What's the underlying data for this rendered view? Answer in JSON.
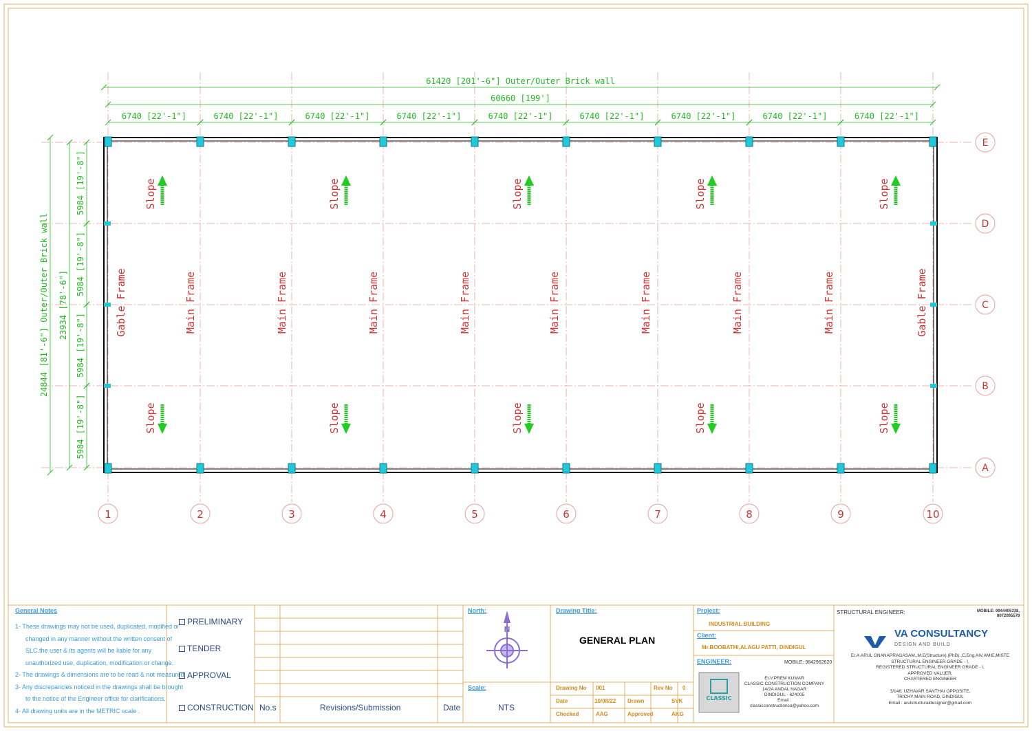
{
  "plan": {
    "overall_outer": "61420 [201'-6\"] Outer/Outer Brick wall",
    "overall_grid": "60660 [199']",
    "bay_label": "6740 [22'-1\"]",
    "bay_count": 9,
    "height_outer": "24844 [81'-6\"] Outer/Outer Brick wall",
    "height_grid": "23934 [78'-6\"]",
    "row_label": "5984 [19'-8\"]",
    "grid_columns": [
      "1",
      "2",
      "3",
      "4",
      "5",
      "6",
      "7",
      "8",
      "9",
      "10"
    ],
    "grid_rows": [
      "E",
      "D",
      "C",
      "B",
      "A"
    ],
    "gable_frame_label": "Gable Frame",
    "main_frame_label": "Main Frame",
    "slope_label": "Slope",
    "colors": {
      "dim": "#22bb22",
      "grid": "#cc3333",
      "column": "#22c7d9",
      "border": "#e0b060",
      "wall": "#000000"
    }
  },
  "title_block": {
    "general_notes_title": "General Notes",
    "notes": [
      "1- These drawings may not be used, duplicated, modified or",
      "   changed in any manner without the written consent of",
      "   SLC.the user & its agents will be liable for any",
      "   unauthorized use, duplication, modification or change.",
      "2- The drawings & dimensions are to be read & not measured.",
      "3- Any discrepancies noticed in the drawings shall be brought",
      "   to the notice of the Engineer office for clarifications.",
      "4- All drawing units are in the METRIC scale ."
    ],
    "stages": [
      "PRELIMINARY",
      "TENDER",
      "APPROVAL",
      "CONSTRUCTION"
    ],
    "rev_nos": "No.s",
    "rev_title": "Revisions/Submission",
    "rev_date": "Date",
    "north_label": "North:",
    "north_letter": "N",
    "scale_label": "Scale:",
    "scale_value": "NTS",
    "drawing_title_label": "Drawing Title:",
    "drawing_title": "GENERAL PLAN",
    "drawing_no_label": "Drawing No",
    "drawing_no": "001",
    "rev_no_label": "Rev No",
    "rev_no": "0",
    "date_label": "Date",
    "date": "10/08/22",
    "drawn_label": "Drawn",
    "drawn": "SVK",
    "checked_label": "Checked",
    "checked": "AAG",
    "approved_label": "Approved",
    "approved": "AKG",
    "project_label": "Project:",
    "project": "INDUSTRIAL BUILDING",
    "client_label": "Client:",
    "client": "Mr.BOOBATHI,ALAGU PATTI, DINDIGUL",
    "engineer_label": "ENGINEER:",
    "engineer_mobile": "MOBILE: 9842962620",
    "engineer_lines": [
      "Er.V.PREM KUMAR",
      "CLASSIC CONSTRUCTION COMPANY",
      "14/2A ANDAL NAGAR",
      "DINDIGUL - 624005",
      "Email : classicconstructionco@yahoo.com"
    ],
    "engineer_logo_text": "CLASSIC",
    "se_label": "STRUCTURAL ENGINEER:",
    "se_mobile_1": "MOBILE: 9944405338,",
    "se_mobile_2": "8072095578",
    "consultancy_name": "VA CONSULTANCY",
    "consultancy_tag": "DESIGN AND BUILD",
    "se_lines": [
      "Er.A.ARUL GNANAPRAGASAM.,M.E(Structure),(PhD).,C.Eng,AIV,AMIE,MISTE",
      "STRUCTURAL ENGINEER GRADE - I,",
      "REGISTERED STRUCTURAL ENGINEER GRADE - I,",
      "APPROVED VALUER,",
      "CHARTERED ENGINEER",
      "",
      "3/146, UZHAVAR SANTHAI OPPOSITE,",
      "TRICHY MAIN ROAD, DINDIGUL",
      "Email : arulstructuraldesigner@gmail.com"
    ]
  }
}
